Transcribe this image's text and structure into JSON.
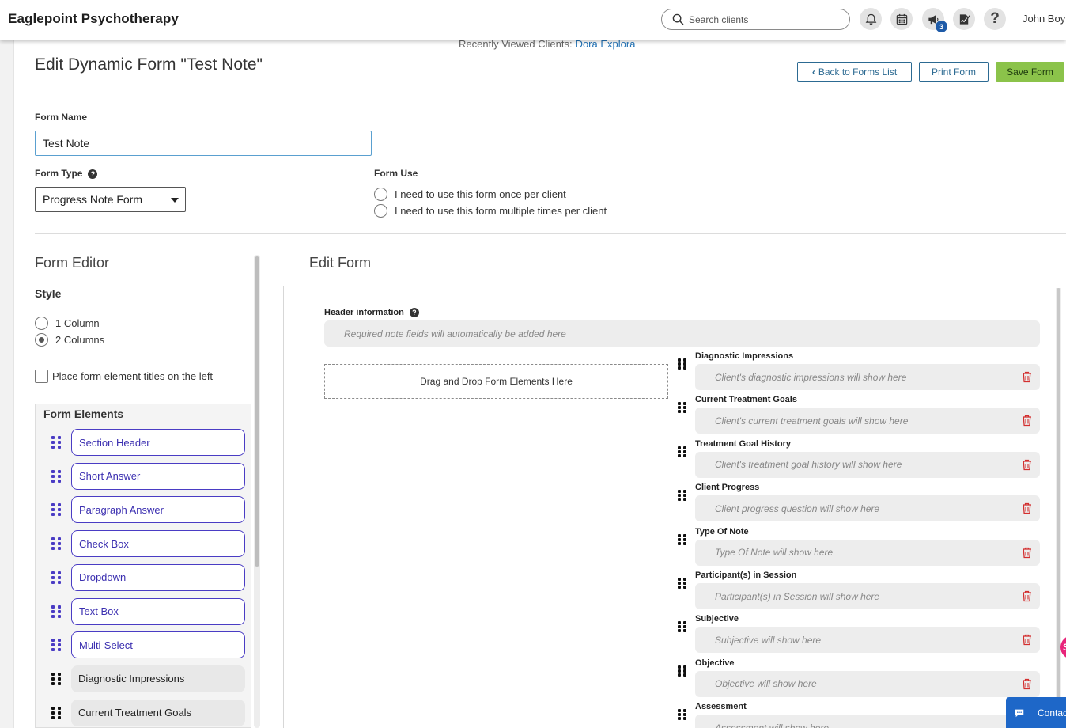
{
  "app": {
    "brand": "Eaglepoint Psychotherapy",
    "user": "John Boy"
  },
  "search": {
    "placeholder": "Search clients"
  },
  "notifications": {
    "announcements_count": "3"
  },
  "recent": {
    "label": "Recently Viewed Clients:",
    "client": "Dora Explora"
  },
  "page": {
    "title": "Edit Dynamic Form \"Test Note\""
  },
  "actions": {
    "back": "Back to Forms List",
    "print": "Print Form",
    "save": "Save Form"
  },
  "form": {
    "name_label": "Form Name",
    "name_value": "Test Note",
    "type_label": "Form Type",
    "type_value": "Progress Note Form",
    "use_label": "Form Use",
    "use_options": [
      "I need to use this form once per client",
      "I need to use this form multiple times per client"
    ]
  },
  "editor": {
    "title": "Form Editor",
    "style_label": "Style",
    "style_options": [
      "1 Column",
      "2 Columns"
    ],
    "style_selected": "2 Columns",
    "titles_left_label": "Place form element titles on the left",
    "elements_title": "Form Elements",
    "elements": [
      {
        "label": "Section Header",
        "kind": "basic"
      },
      {
        "label": "Short Answer",
        "kind": "basic"
      },
      {
        "label": "Paragraph Answer",
        "kind": "basic"
      },
      {
        "label": "Check Box",
        "kind": "basic"
      },
      {
        "label": "Dropdown",
        "kind": "basic"
      },
      {
        "label": "Text Box",
        "kind": "basic"
      },
      {
        "label": "Multi-Select",
        "kind": "basic"
      },
      {
        "label": "Diagnostic Impressions",
        "kind": "system"
      },
      {
        "label": "Current Treatment Goals",
        "kind": "system"
      }
    ]
  },
  "edit_form": {
    "title": "Edit Form",
    "header_label": "Header information",
    "header_placeholder": "Required note fields will automatically be added here",
    "dropzone": "Drag and Drop Form Elements Here",
    "fields": [
      {
        "label": "Diagnostic Impressions",
        "placeholder": "Client's diagnostic impressions will show here"
      },
      {
        "label": "Current Treatment Goals",
        "placeholder": "Client's current treatment goals will show here"
      },
      {
        "label": "Treatment Goal History",
        "placeholder": "Client's treatment goal history will show here"
      },
      {
        "label": "Client Progress",
        "placeholder": "Client progress question will show here"
      },
      {
        "label": "Type Of Note",
        "placeholder": "Type Of Note will show here"
      },
      {
        "label": "Participant(s) in Session",
        "placeholder": "Participant(s) in Session will show here"
      },
      {
        "label": "Subjective",
        "placeholder": "Subjective will show here"
      },
      {
        "label": "Objective",
        "placeholder": "Objective will show here"
      },
      {
        "label": "Assessment",
        "placeholder": "Assessment will show here"
      }
    ]
  },
  "widgets": {
    "contact": "Contact",
    "bubble": "S"
  },
  "colors": {
    "accent": "#2c6a92",
    "save": "#8bc34a",
    "element_border": "#4a3cc4",
    "trash": "#d32f2f",
    "contact": "#1e67c8"
  }
}
